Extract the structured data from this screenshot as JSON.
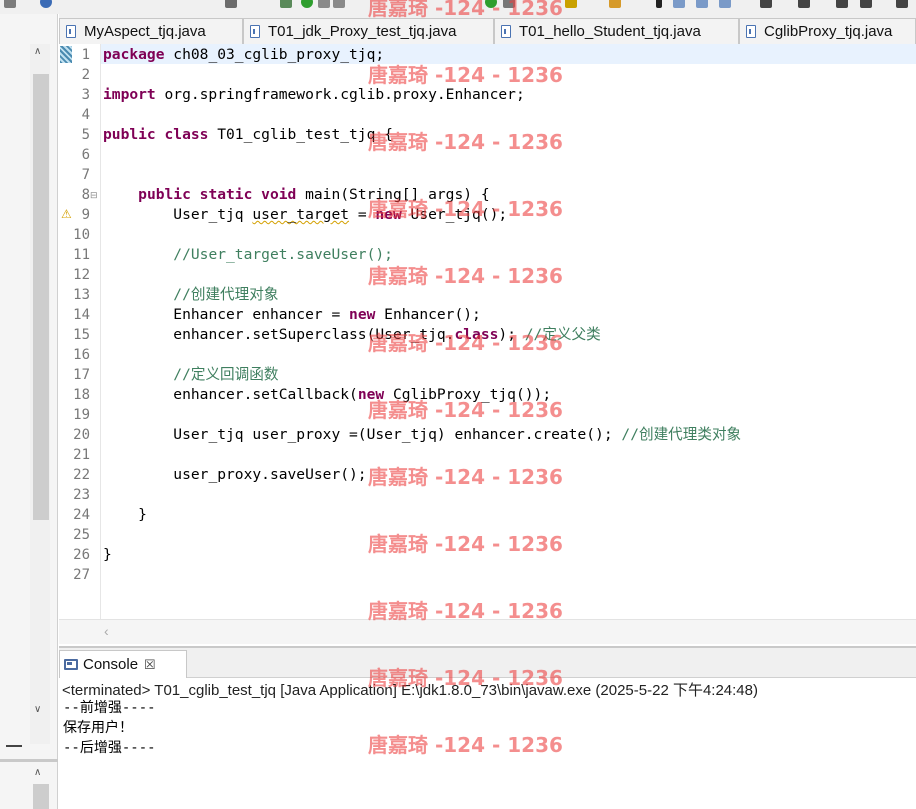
{
  "tabs": [
    {
      "label": "MyAspect_tjq.java"
    },
    {
      "label": "T01_jdk_Proxy_test_tjq.java"
    },
    {
      "label": "T01_hello_Student_tjq.java"
    },
    {
      "label": "CglibProxy_tjq.java"
    }
  ],
  "editor": {
    "line_numbers": [
      "1",
      "2",
      "3",
      "4",
      "5",
      "6",
      "7",
      "8",
      "9",
      "10",
      "11",
      "12",
      "13",
      "14",
      "15",
      "16",
      "17",
      "18",
      "19",
      "20",
      "21",
      "22",
      "23",
      "24",
      "25",
      "26",
      "27"
    ],
    "code": {
      "l1_kw": "package",
      "l1_text": " ch08_03_cglib_proxy_tjq;",
      "l3_kw": "import",
      "l3_text": " org.springframework.cglib.proxy.Enhancer;",
      "l5_kw": "public class",
      "l5_text": " T01_cglib_test_tjq {",
      "l8_indent": "    ",
      "l8_kw": "public static void",
      "l8_text": " main(String[] args) {",
      "l9_indent": "        ",
      "l9_a": "User_tjq ",
      "l9_warn": "user_target",
      "l9_b": " = ",
      "l9_kw": "new",
      "l9_c": " User_tjq();",
      "l11_indent": "        ",
      "l11_comment": "//User_target.saveUser();",
      "l13_indent": "        ",
      "l13_comment": "//创建代理对象",
      "l14_indent": "        ",
      "l14_a": "Enhancer enhancer = ",
      "l14_kw": "new",
      "l14_b": " Enhancer();",
      "l15_indent": "        ",
      "l15_a": "enhancer.setSuperclass(User_tjq.",
      "l15_kw": "class",
      "l15_b": "); ",
      "l15_comment": "//定义父类",
      "l17_indent": "        ",
      "l17_comment": "//定义回调函数",
      "l18_indent": "        ",
      "l18_a": "enhancer.setCallback(",
      "l18_kw": "new",
      "l18_b": " CglibProxy_tjq());",
      "l20_indent": "        ",
      "l20_a": "User_tjq user_proxy =(User_tjq) enhancer.create(); ",
      "l20_comment": "//创建代理类对象",
      "l22_indent": "        ",
      "l22_text": "user_proxy.saveUser();",
      "l24_indent": "    ",
      "l24_text": "}",
      "l26_text": "}"
    }
  },
  "console": {
    "tab_label": "Console",
    "close_symbol": "☒",
    "status": "<terminated> T01_cglib_test_tjq [Java Application] E:\\jdk1.8.0_73\\bin\\javaw.exe (2025-5-22 下午4:24:48)",
    "output": [
      "--前增强----",
      "保存用户！",
      "--后增强----"
    ]
  },
  "watermark": "唐嘉琦 -124 - 1236",
  "colors": {
    "keyword": "#7f0055",
    "comment": "#3f7f5f",
    "watermark": "#ec3c3c",
    "current_line": "#e8f2fe"
  }
}
